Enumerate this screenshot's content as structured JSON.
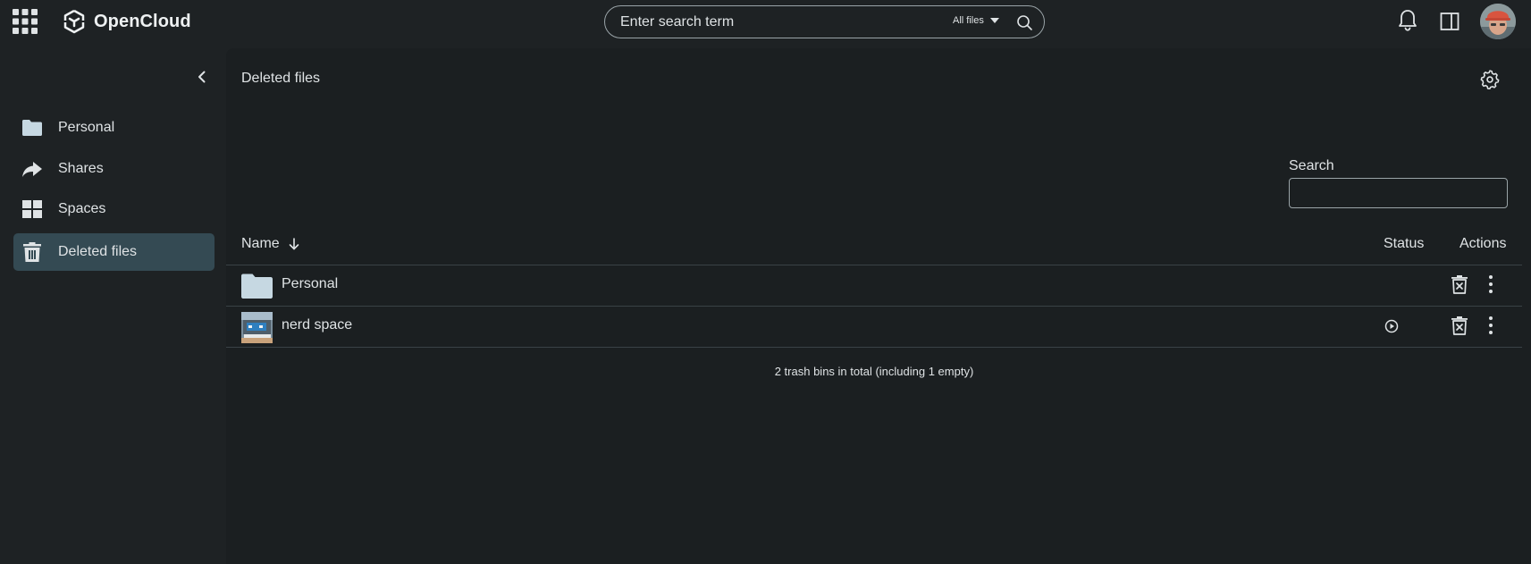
{
  "app": {
    "name": "OpenCloud"
  },
  "search": {
    "placeholder": "Enter search term",
    "scope_label": "All files"
  },
  "sidebar": {
    "items": [
      {
        "label": "Personal",
        "icon": "folder-icon"
      },
      {
        "label": "Shares",
        "icon": "share-icon"
      },
      {
        "label": "Spaces",
        "icon": "spaces-icon"
      },
      {
        "label": "Deleted files",
        "icon": "trash-icon",
        "active": true
      }
    ]
  },
  "main": {
    "title": "Deleted files",
    "filter": {
      "label": "Search",
      "value": ""
    },
    "table": {
      "columns": {
        "name": "Name",
        "status": "Status",
        "actions": "Actions"
      },
      "sort": "descending",
      "rows": [
        {
          "name": "Personal",
          "icon": "folder-icon",
          "has_status": false
        },
        {
          "name": "nerd space",
          "icon": "space-thumbnail-image",
          "has_status": true
        }
      ]
    },
    "footer": "2 trash bins in total (including 1 empty)"
  },
  "colors": {
    "background": "#1e2224",
    "content_background": "#1b1f21",
    "active_nav": "#344a53",
    "folder": "#c6d8e2",
    "text": "#dfe3e5"
  }
}
